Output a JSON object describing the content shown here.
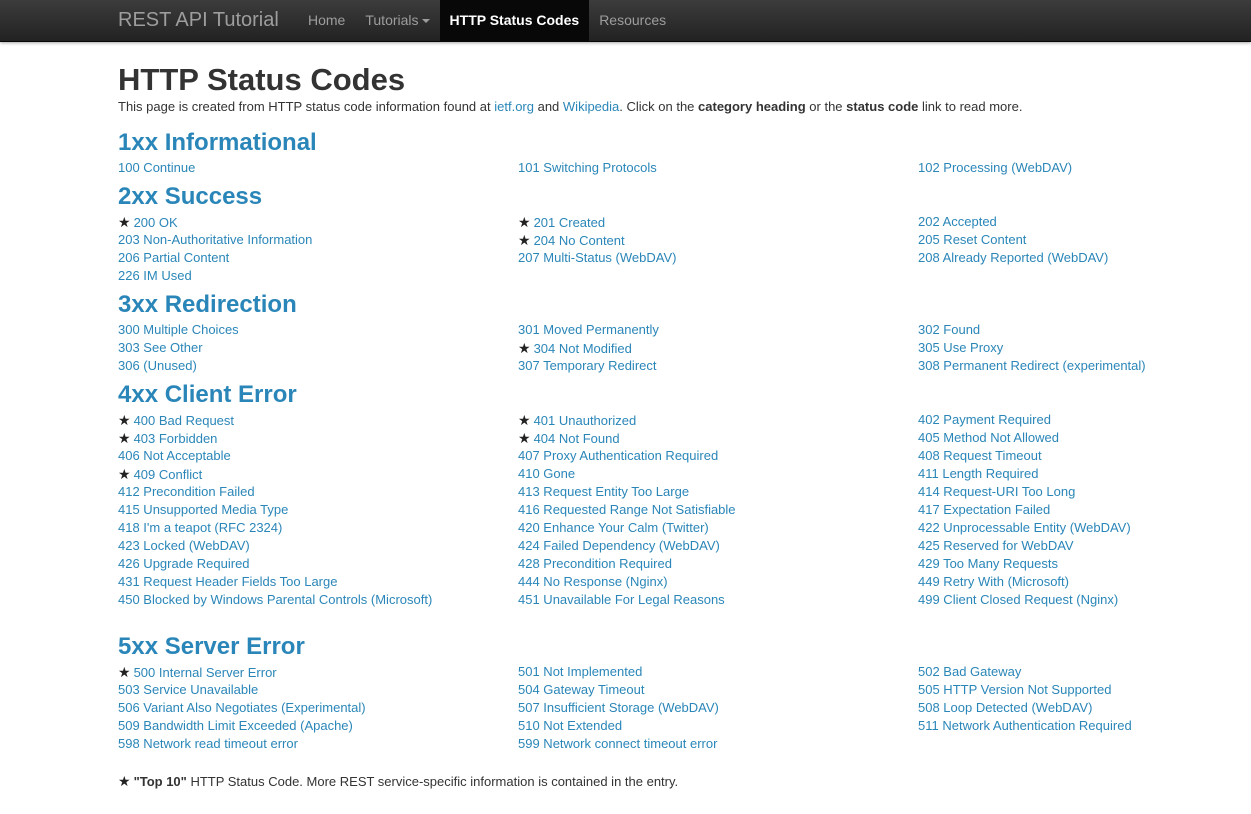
{
  "navbar": {
    "brand": "REST API Tutorial",
    "items": [
      {
        "label": "Home",
        "active": false,
        "dropdown": false
      },
      {
        "label": "Tutorials",
        "active": false,
        "dropdown": true
      },
      {
        "label": "HTTP Status Codes",
        "active": true,
        "dropdown": false
      },
      {
        "label": "Resources",
        "active": false,
        "dropdown": false
      }
    ]
  },
  "page": {
    "title": "HTTP Status Codes",
    "intro_prefix": "This page is created from HTTP status code information found at ",
    "intro_link1": "ietf.org",
    "intro_and": " and ",
    "intro_link2": "Wikipedia",
    "intro_mid": ". Click on the ",
    "intro_bold1": "category heading",
    "intro_or": " or the ",
    "intro_bold2": "status code",
    "intro_suffix": " link to read more."
  },
  "sections": [
    {
      "title": "1xx Informational",
      "codes": [
        {
          "label": "100 Continue",
          "top10": false
        },
        {
          "label": "101 Switching Protocols",
          "top10": false
        },
        {
          "label": "102 Processing (WebDAV)",
          "top10": false
        }
      ]
    },
    {
      "title": "2xx Success",
      "codes": [
        {
          "label": "200 OK",
          "top10": true
        },
        {
          "label": "201 Created",
          "top10": true
        },
        {
          "label": "202 Accepted",
          "top10": false
        },
        {
          "label": "203 Non-Authoritative Information",
          "top10": false
        },
        {
          "label": "204 No Content",
          "top10": true
        },
        {
          "label": "205 Reset Content",
          "top10": false
        },
        {
          "label": "206 Partial Content",
          "top10": false
        },
        {
          "label": "207 Multi-Status (WebDAV)",
          "top10": false
        },
        {
          "label": "208 Already Reported (WebDAV)",
          "top10": false
        },
        {
          "label": "226 IM Used",
          "top10": false
        }
      ]
    },
    {
      "title": "3xx Redirection",
      "codes": [
        {
          "label": "300 Multiple Choices",
          "top10": false
        },
        {
          "label": "301 Moved Permanently",
          "top10": false
        },
        {
          "label": "302 Found",
          "top10": false
        },
        {
          "label": "303 See Other",
          "top10": false
        },
        {
          "label": "304 Not Modified",
          "top10": true
        },
        {
          "label": "305 Use Proxy",
          "top10": false
        },
        {
          "label": "306 (Unused)",
          "top10": false
        },
        {
          "label": "307 Temporary Redirect",
          "top10": false
        },
        {
          "label": "308 Permanent Redirect (experimental)",
          "top10": false
        }
      ]
    },
    {
      "title": "4xx Client Error",
      "codes": [
        {
          "label": "400 Bad Request",
          "top10": true
        },
        {
          "label": "401 Unauthorized",
          "top10": true
        },
        {
          "label": "402 Payment Required",
          "top10": false
        },
        {
          "label": "403 Forbidden",
          "top10": true
        },
        {
          "label": "404 Not Found",
          "top10": true
        },
        {
          "label": "405 Method Not Allowed",
          "top10": false
        },
        {
          "label": "406 Not Acceptable",
          "top10": false
        },
        {
          "label": "407 Proxy Authentication Required",
          "top10": false
        },
        {
          "label": "408 Request Timeout",
          "top10": false
        },
        {
          "label": "409 Conflict",
          "top10": true
        },
        {
          "label": "410 Gone",
          "top10": false
        },
        {
          "label": "411 Length Required",
          "top10": false
        },
        {
          "label": "412 Precondition Failed",
          "top10": false
        },
        {
          "label": "413 Request Entity Too Large",
          "top10": false
        },
        {
          "label": "414 Request-URI Too Long",
          "top10": false
        },
        {
          "label": "415 Unsupported Media Type",
          "top10": false
        },
        {
          "label": "416 Requested Range Not Satisfiable",
          "top10": false
        },
        {
          "label": "417 Expectation Failed",
          "top10": false
        },
        {
          "label": "418 I'm a teapot (RFC 2324)",
          "top10": false
        },
        {
          "label": "420 Enhance Your Calm (Twitter)",
          "top10": false
        },
        {
          "label": "422 Unprocessable Entity (WebDAV)",
          "top10": false
        },
        {
          "label": "423 Locked (WebDAV)",
          "top10": false
        },
        {
          "label": "424 Failed Dependency (WebDAV)",
          "top10": false
        },
        {
          "label": "425 Reserved for WebDAV",
          "top10": false
        },
        {
          "label": "426 Upgrade Required",
          "top10": false
        },
        {
          "label": "428 Precondition Required",
          "top10": false
        },
        {
          "label": "429 Too Many Requests",
          "top10": false
        },
        {
          "label": "431 Request Header Fields Too Large",
          "top10": false
        },
        {
          "label": "444 No Response (Nginx)",
          "top10": false
        },
        {
          "label": "449 Retry With (Microsoft)",
          "top10": false
        },
        {
          "label": "450 Blocked by Windows Parental Controls (Microsoft)",
          "top10": false
        },
        {
          "label": "451 Unavailable For Legal Reasons",
          "top10": false
        },
        {
          "label": "499 Client Closed Request (Nginx)",
          "top10": false
        }
      ]
    },
    {
      "title": "5xx Server Error",
      "codes": [
        {
          "label": "500 Internal Server Error",
          "top10": true
        },
        {
          "label": "501 Not Implemented",
          "top10": false
        },
        {
          "label": "502 Bad Gateway",
          "top10": false
        },
        {
          "label": "503 Service Unavailable",
          "top10": false
        },
        {
          "label": "504 Gateway Timeout",
          "top10": false
        },
        {
          "label": "505 HTTP Version Not Supported",
          "top10": false
        },
        {
          "label": "506 Variant Also Negotiates (Experimental)",
          "top10": false
        },
        {
          "label": "507 Insufficient Storage (WebDAV)",
          "top10": false
        },
        {
          "label": "508 Loop Detected (WebDAV)",
          "top10": false
        },
        {
          "label": "509 Bandwidth Limit Exceeded (Apache)",
          "top10": false
        },
        {
          "label": "510 Not Extended",
          "top10": false
        },
        {
          "label": "511 Network Authentication Required",
          "top10": false
        },
        {
          "label": "598 Network read timeout error",
          "top10": false
        },
        {
          "label": "599 Network connect timeout error",
          "top10": false
        }
      ]
    }
  ],
  "footer": {
    "star_glyph": "★",
    "bold": "\"Top 10\"",
    "text": " HTTP Status Code. More REST service-specific information is contained in the entry."
  },
  "icons": {
    "star": "star-icon",
    "caret": "caret-down-icon"
  },
  "colors": {
    "link": "#2a86b8",
    "heading": "#1e88c7",
    "navbar": "#222222",
    "text": "#333333"
  }
}
